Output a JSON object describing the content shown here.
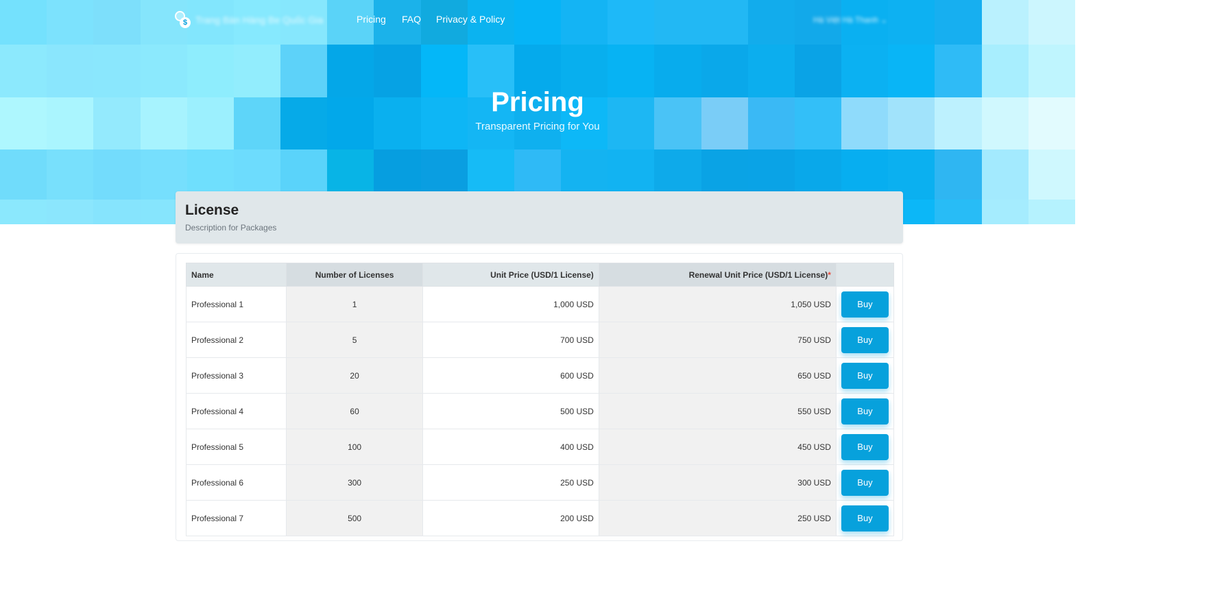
{
  "nav": {
    "brand": "Trang Bán Hàng Be Quốc Gia",
    "links": [
      "Pricing",
      "FAQ",
      "Privacy & Policy"
    ],
    "user": "Hà Việt Hà Thanh"
  },
  "hero": {
    "title": "Pricing",
    "subtitle": "Transparent Pricing for You"
  },
  "license": {
    "title": "License",
    "description": "Description for Packages"
  },
  "table": {
    "headers": {
      "name": "Name",
      "num": "Number of Licenses",
      "unit": "Unit Price (USD/1 License)",
      "renew": "Renewal Unit Price (USD/1 License)",
      "renew_mark": "*"
    },
    "buy_label": "Buy",
    "rows": [
      {
        "name": "Professional 1",
        "num": "1",
        "unit": "1,000 USD",
        "renew": "1,050 USD"
      },
      {
        "name": "Professional 2",
        "num": "5",
        "unit": "700 USD",
        "renew": "750 USD"
      },
      {
        "name": "Professional 3",
        "num": "20",
        "unit": "600 USD",
        "renew": "650 USD"
      },
      {
        "name": "Professional 4",
        "num": "60",
        "unit": "500 USD",
        "renew": "550 USD"
      },
      {
        "name": "Professional 5",
        "num": "100",
        "unit": "400 USD",
        "renew": "450 USD"
      },
      {
        "name": "Professional 6",
        "num": "300",
        "unit": "250 USD",
        "renew": "300 USD"
      },
      {
        "name": "Professional 7",
        "num": "500",
        "unit": "200 USD",
        "renew": "250 USD"
      }
    ]
  },
  "colors": {
    "accent": "#07a1dc",
    "hero_tiles": [
      [
        "#74e1fd",
        "#7ce2fd",
        "#7ddffb",
        "#85e5fc",
        "#82e6fd",
        "#86e9fe",
        "#86e7fd",
        "#5ad3f8",
        "#1bb2ea",
        "#11aadf",
        "#0bb3f0",
        "#06b4f6",
        "#14b4f4",
        "#1eb9f8",
        "#22b8f4",
        "#22b8f4",
        "#12acec",
        "#12a9ea",
        "#0ab0f1",
        "#0db1f2",
        "#17aff0",
        "#baf1fe",
        "#ccf6fe"
      ],
      [
        "#8ce9fd",
        "#8ae6fd",
        "#8ae7fd",
        "#8be9fd",
        "#8eedfd",
        "#92edfd",
        "#5dd2f9",
        "#04a7e8",
        "#06a2e4",
        "#04b7f8",
        "#28bff8",
        "#05aaec",
        "#08afee",
        "#07b3f3",
        "#08aced",
        "#0aa8ea",
        "#0caeee",
        "#0aa3e6",
        "#0bb1f2",
        "#09b5f6",
        "#2fbbf6",
        "#a8eefe",
        "#bff5fe"
      ],
      [
        "#aef7fe",
        "#aaf5fe",
        "#94eafd",
        "#a7f3fe",
        "#9cf0fe",
        "#5ed5f9",
        "#06aae8",
        "#02a8ea",
        "#0ab0ef",
        "#0eb6f5",
        "#14b6f4",
        "#0fb0ef",
        "#0db8f7",
        "#1db7f3",
        "#4ac3f6",
        "#7acdf7",
        "#3ab9f5",
        "#33bff8",
        "#8fdbfb",
        "#a1e3fb",
        "#bdf1fe",
        "#d0f8fe",
        "#e2fbfe"
      ],
      [
        "#70dcfb",
        "#78e0fc",
        "#73dcfc",
        "#76dffd",
        "#6fdffd",
        "#6ddcfd",
        "#5ad3fa",
        "#08b4e6",
        "#069ee0",
        "#0a9ee1",
        "#16bbf6",
        "#2fbaf6",
        "#14b3f1",
        "#12b3f2",
        "#0eaaea",
        "#0aa3e5",
        "#0aa3e6",
        "#09a8ea",
        "#07aef0",
        "#0bb0f0",
        "#2fb6f2",
        "#a3eafe",
        "#cff8fe"
      ],
      [
        "#8be8fd",
        "#8be6fd",
        "#86e4fd",
        "#86e5fd",
        "#87e3fd",
        "#8be8fd",
        "#8be8fd",
        "#7ce1fd",
        "#35c0f5",
        "#22b6ef",
        "#16b6f4",
        "#1ab8f6",
        "#1cbbf9",
        "#1db8f6",
        "#16b6f5",
        "#12b4f4",
        "#11b6f6",
        "#0ab2f3",
        "#09b4f5",
        "#0cb7f7",
        "#28bcf6",
        "#a5ecfe",
        "#b5f2fe"
      ]
    ]
  }
}
